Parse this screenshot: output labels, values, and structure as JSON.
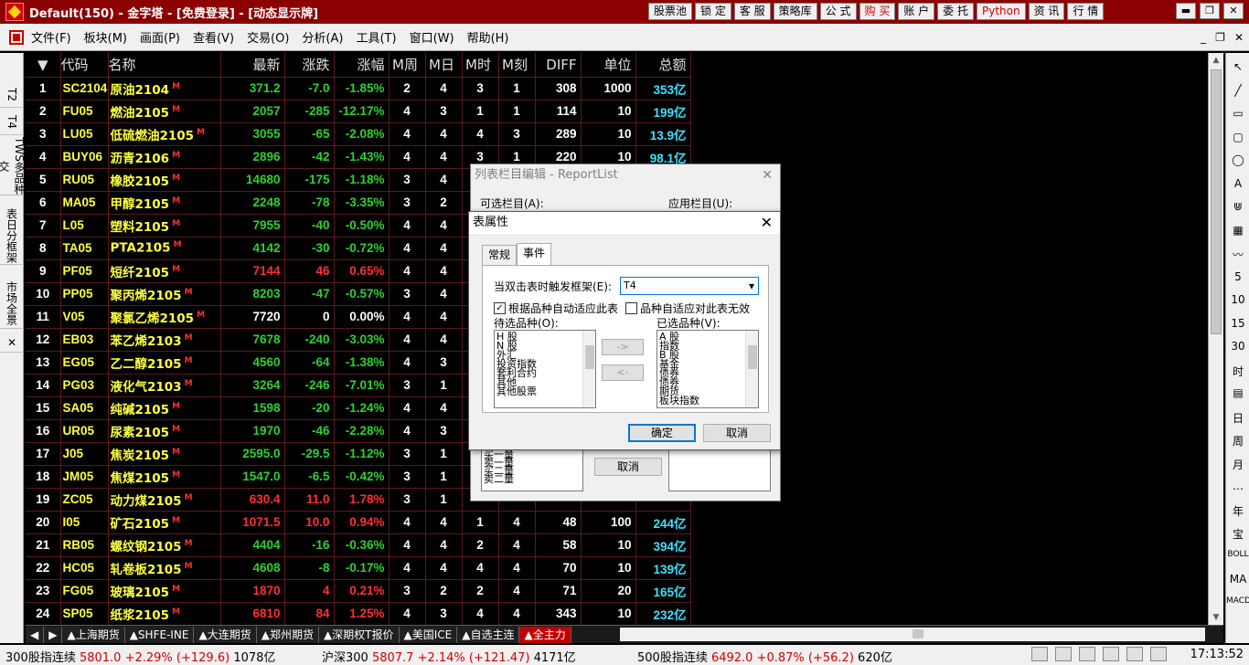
{
  "window": {
    "title": "Default(150) - 金字塔 - [免费登录] - [动态显示牌]",
    "buttons": [
      {
        "label": "股票池",
        "hot": false
      },
      {
        "label": "锁 定",
        "hot": false
      },
      {
        "label": "客 服",
        "hot": false
      },
      {
        "label": "策略库",
        "hot": false
      },
      {
        "label": "公 式",
        "hot": false
      },
      {
        "label": "购 买",
        "hot": true
      },
      {
        "label": "账 户",
        "hot": false
      },
      {
        "label": "委 托",
        "hot": false
      },
      {
        "label": "Python",
        "hot": true
      },
      {
        "label": "资 讯",
        "hot": false
      },
      {
        "label": "行 情",
        "hot": false
      }
    ],
    "controls": [
      "▬",
      "❐",
      "✕"
    ]
  },
  "menu": {
    "items": [
      "文件(F)",
      "板块(M)",
      "画面(P)",
      "查看(V)",
      "交易(O)",
      "分析(A)",
      "工具(T)",
      "窗口(W)",
      "帮助(H)"
    ],
    "right": [
      "_",
      "❐",
      "✕"
    ]
  },
  "left_tabs": [
    "T2",
    "T4",
    "TWS多品种交",
    "表日分框架",
    "市场全景",
    "✕"
  ],
  "table": {
    "sort_icon": "▼",
    "headers": [
      "代码",
      "名称",
      "最新",
      "涨跌",
      "涨幅",
      "M周",
      "M日",
      "M时",
      "M刻",
      "DIFF",
      "单位",
      "总额"
    ],
    "rows": [
      {
        "idx": "1",
        "code": "SC2104",
        "name": "原油2104",
        "last": "371.2",
        "chg": "-7.0",
        "pct": "-1.85%",
        "dir": "down",
        "mw": "2",
        "md": "4",
        "mh": "3",
        "mk": "1",
        "diff": "308",
        "unit": "1000",
        "amt": "353亿"
      },
      {
        "idx": "2",
        "code": "FU05",
        "name": "燃油2105",
        "last": "2057",
        "chg": "-285",
        "pct": "-12.17%",
        "dir": "down",
        "mw": "4",
        "md": "3",
        "mh": "1",
        "mk": "1",
        "diff": "114",
        "unit": "10",
        "amt": "199亿"
      },
      {
        "idx": "3",
        "code": "LU05",
        "name": "低硫燃油2105",
        "last": "3055",
        "chg": "-65",
        "pct": "-2.08%",
        "dir": "down",
        "mw": "4",
        "md": "4",
        "mh": "4",
        "mk": "3",
        "diff": "289",
        "unit": "10",
        "amt": "13.9亿"
      },
      {
        "idx": "4",
        "code": "BUY06",
        "name": "沥青2106",
        "last": "2896",
        "chg": "-42",
        "pct": "-1.43%",
        "dir": "down",
        "mw": "4",
        "md": "4",
        "mh": "3",
        "mk": "1",
        "diff": "220",
        "unit": "10",
        "amt": "98.1亿"
      },
      {
        "idx": "5",
        "code": "RU05",
        "name": "橡胶2105",
        "last": "14680",
        "chg": "-175",
        "pct": "-1.18%",
        "dir": "down",
        "mw": "3",
        "md": "4",
        "mh": "",
        "mk": "",
        "diff": "",
        "unit": "",
        "amt": ""
      },
      {
        "idx": "6",
        "code": "MA05",
        "name": "甲醇2105",
        "last": "2248",
        "chg": "-78",
        "pct": "-3.35%",
        "dir": "down",
        "mw": "3",
        "md": "2",
        "mh": "",
        "mk": "",
        "diff": "",
        "unit": "",
        "amt": ""
      },
      {
        "idx": "7",
        "code": "L05",
        "name": "塑料2105",
        "last": "7955",
        "chg": "-40",
        "pct": "-0.50%",
        "dir": "down",
        "mw": "4",
        "md": "4",
        "mh": "",
        "mk": "",
        "diff": "",
        "unit": "",
        "amt": ""
      },
      {
        "idx": "8",
        "code": "TA05",
        "name": "PTA2105",
        "last": "4142",
        "chg": "-30",
        "pct": "-0.72%",
        "dir": "down",
        "mw": "4",
        "md": "4",
        "mh": "",
        "mk": "",
        "diff": "",
        "unit": "",
        "amt": ""
      },
      {
        "idx": "9",
        "code": "PF05",
        "name": "短纤2105",
        "last": "7144",
        "chg": "46",
        "pct": "0.65%",
        "dir": "up",
        "mw": "4",
        "md": "4",
        "mh": "",
        "mk": "",
        "diff": "",
        "unit": "",
        "amt": ""
      },
      {
        "idx": "10",
        "code": "PP05",
        "name": "聚丙烯2105",
        "last": "8203",
        "chg": "-47",
        "pct": "-0.57%",
        "dir": "down",
        "mw": "3",
        "md": "4",
        "mh": "",
        "mk": "",
        "diff": "",
        "unit": "",
        "amt": ""
      },
      {
        "idx": "11",
        "code": "V05",
        "name": "聚氯乙烯2105",
        "last": "7720",
        "chg": "0",
        "pct": "0.00%",
        "dir": "flat",
        "mw": "4",
        "md": "4",
        "mh": "",
        "mk": "",
        "diff": "",
        "unit": "",
        "amt": ""
      },
      {
        "idx": "12",
        "code": "EB03",
        "name": "苯乙烯2103",
        "last": "7678",
        "chg": "-240",
        "pct": "-3.03%",
        "dir": "down",
        "mw": "4",
        "md": "4",
        "mh": "",
        "mk": "",
        "diff": "",
        "unit": "",
        "amt": ""
      },
      {
        "idx": "13",
        "code": "EG05",
        "name": "乙二醇2105",
        "last": "4560",
        "chg": "-64",
        "pct": "-1.38%",
        "dir": "down",
        "mw": "4",
        "md": "3",
        "mh": "",
        "mk": "",
        "diff": "",
        "unit": "",
        "amt": ""
      },
      {
        "idx": "14",
        "code": "PG03",
        "name": "液化气2103",
        "last": "3264",
        "chg": "-246",
        "pct": "-7.01%",
        "dir": "down",
        "mw": "3",
        "md": "1",
        "mh": "",
        "mk": "",
        "diff": "",
        "unit": "",
        "amt": ""
      },
      {
        "idx": "15",
        "code": "SA05",
        "name": "纯碱2105",
        "last": "1598",
        "chg": "-20",
        "pct": "-1.24%",
        "dir": "down",
        "mw": "4",
        "md": "4",
        "mh": "",
        "mk": "",
        "diff": "",
        "unit": "",
        "amt": ""
      },
      {
        "idx": "16",
        "code": "UR05",
        "name": "尿素2105",
        "last": "1970",
        "chg": "-46",
        "pct": "-2.28%",
        "dir": "down",
        "mw": "4",
        "md": "3",
        "mh": "",
        "mk": "",
        "diff": "",
        "unit": "",
        "amt": ""
      },
      {
        "idx": "17",
        "code": "J05",
        "name": "焦炭2105",
        "last": "2595.0",
        "chg": "-29.5",
        "pct": "-1.12%",
        "dir": "down",
        "mw": "3",
        "md": "1",
        "mh": "",
        "mk": "",
        "diff": "",
        "unit": "",
        "amt": ""
      },
      {
        "idx": "18",
        "code": "JM05",
        "name": "焦煤2105",
        "last": "1547.0",
        "chg": "-6.5",
        "pct": "-0.42%",
        "dir": "down",
        "mw": "3",
        "md": "1",
        "mh": "",
        "mk": "",
        "diff": "",
        "unit": "",
        "amt": ""
      },
      {
        "idx": "19",
        "code": "ZC05",
        "name": "动力煤2105",
        "last": "630.4",
        "chg": "11.0",
        "pct": "1.78%",
        "dir": "up",
        "mw": "3",
        "md": "1",
        "mh": "",
        "mk": "",
        "diff": "",
        "unit": "",
        "amt": ""
      },
      {
        "idx": "20",
        "code": "I05",
        "name": "矿石2105",
        "last": "1071.5",
        "chg": "10.0",
        "pct": "0.94%",
        "dir": "up",
        "mw": "4",
        "md": "4",
        "mh": "1",
        "mk": "4",
        "diff": "48",
        "unit": "100",
        "amt": "244亿"
      },
      {
        "idx": "21",
        "code": "RB05",
        "name": "螺纹钢2105",
        "last": "4404",
        "chg": "-16",
        "pct": "-0.36%",
        "dir": "down",
        "mw": "4",
        "md": "4",
        "mh": "2",
        "mk": "4",
        "diff": "58",
        "unit": "10",
        "amt": "394亿"
      },
      {
        "idx": "22",
        "code": "HC05",
        "name": "轧卷板2105",
        "last": "4608",
        "chg": "-8",
        "pct": "-0.17%",
        "dir": "down",
        "mw": "4",
        "md": "4",
        "mh": "4",
        "mk": "4",
        "diff": "70",
        "unit": "10",
        "amt": "139亿"
      },
      {
        "idx": "23",
        "code": "FG05",
        "name": "玻璃2105",
        "last": "1870",
        "chg": "4",
        "pct": "0.21%",
        "dir": "up",
        "mw": "3",
        "md": "2",
        "mh": "2",
        "mk": "4",
        "diff": "71",
        "unit": "20",
        "amt": "165亿"
      },
      {
        "idx": "24",
        "code": "SP05",
        "name": "纸浆2105",
        "last": "6810",
        "chg": "84",
        "pct": "1.25%",
        "dir": "up",
        "mw": "4",
        "md": "3",
        "mh": "4",
        "mk": "4",
        "diff": "343",
        "unit": "10",
        "amt": "232亿"
      }
    ]
  },
  "right_tools": [
    "↖",
    "╱",
    "▭",
    "▢",
    "◯",
    "A",
    "⋓",
    "▦",
    "〰",
    "5",
    "10",
    "15",
    "30",
    "时",
    "▤",
    "日",
    "周",
    "月",
    "…",
    "年",
    "宝",
    "BOLL",
    "MA",
    "MACD"
  ],
  "bottom_tabs": [
    {
      "label": "▲上海期货",
      "active": false
    },
    {
      "label": "▲SHFE-INE",
      "active": false
    },
    {
      "label": "▲大连期货",
      "active": false
    },
    {
      "label": "▲郑州期货",
      "active": false
    },
    {
      "label": "▲深期权T报价",
      "active": false
    },
    {
      "label": "▲美国ICE",
      "active": false
    },
    {
      "label": "▲自选主连",
      "active": false
    },
    {
      "label": "▲全主力",
      "active": true
    }
  ],
  "status": {
    "idx1_name": "300股指连续",
    "idx1_val": "5801.0 +2.29% (+129.6)",
    "idx1_amt": "1078亿",
    "idx2_name": "沪深300",
    "idx2_val": "5807.7 +2.14% (+121.47)",
    "idx2_amt": "4171亿",
    "idx3_name": "500股指连续",
    "idx3_val": "6492.0 +0.87% (+56.2)",
    "idx3_amt": "620亿",
    "clock": "17:13:52"
  },
  "dialog_bg": {
    "title": "列表栏目编辑 - ReportList",
    "left_label": "可选栏目(A):",
    "right_label": "应用栏目(U):",
    "list_items": [
      "买一量",
      "卖一量",
      "买二量",
      "卖二量"
    ],
    "cancel": "取消"
  },
  "dialog": {
    "title": "表属性",
    "tabs": [
      {
        "label": "常规",
        "active": false
      },
      {
        "label": "事件",
        "active": true
      }
    ],
    "trigger_label": "当双击表时触发框架(E):",
    "trigger_value": "T4",
    "auto_adapt_label": "根据品种自动适应此表",
    "auto_adapt_checked": true,
    "invalid_label": "品种自适应对此表无效",
    "invalid_checked": false,
    "avail_label": "待选品种(O):",
    "avail_items": [
      "H 股",
      "N 股",
      "外汇",
      "投资指数",
      "套利合约",
      "其他",
      "其他股票"
    ],
    "sel_label": "已选品种(V):",
    "sel_items": [
      "A 股",
      "指数",
      "B 股",
      "基金",
      "债券",
      "债券",
      "期货",
      "板块指数"
    ],
    "add_btn": "->",
    "remove_btn": "<-",
    "ok": "确定",
    "cancel": "取消"
  }
}
